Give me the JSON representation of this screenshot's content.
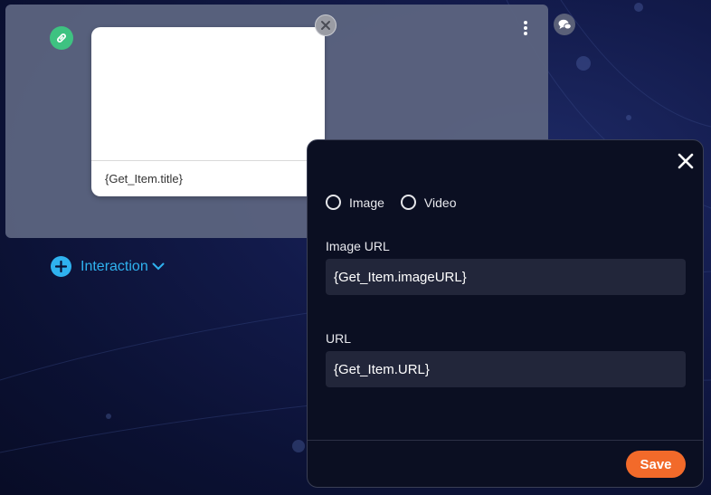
{
  "card": {
    "title_placeholder": "{Get_Item.title}",
    "icons": [
      "link-icon",
      "remove-icon",
      "more-options-icon",
      "chat-icon"
    ]
  },
  "interaction": {
    "label": "Interaction",
    "icons": [
      "plus-icon",
      "chevron-down-icon"
    ]
  },
  "modal": {
    "media_options": [
      {
        "label": "Image",
        "selected": false
      },
      {
        "label": "Video",
        "selected": false
      }
    ],
    "image_url": {
      "label": "Image URL",
      "value": "{Get_Item.imageURL}"
    },
    "url": {
      "label": "URL",
      "value": "{Get_Item.URL}"
    },
    "save_label": "Save"
  },
  "colors": {
    "accent_blue": "#2fb2ef",
    "save_orange": "#f26a2a",
    "link_green": "#3ec281",
    "modal_bg": "#0b0f22"
  }
}
